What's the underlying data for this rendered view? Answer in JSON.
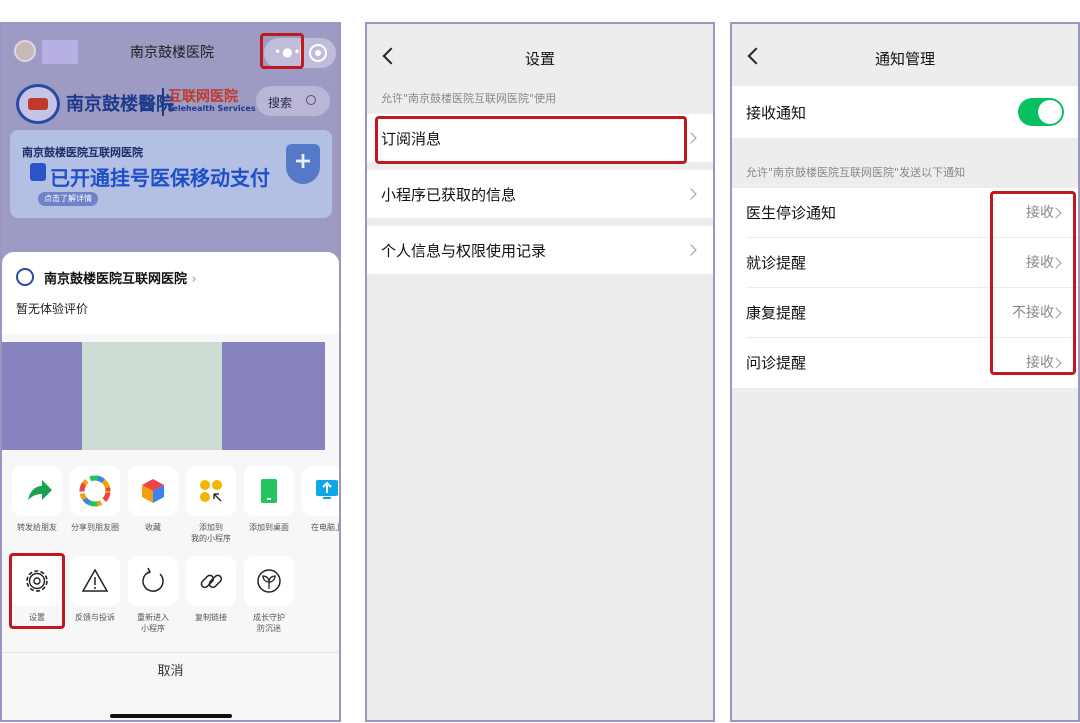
{
  "colors": {
    "accent_green": "#07c160",
    "highlight_red": "#c0191d",
    "panel_border": "#9b97c4"
  },
  "panel1": {
    "title": "南京鼓楼医院",
    "logo_text": "南京鼓楼醫院",
    "logo_net": "互联网医院",
    "logo_en": "Telehealth Services",
    "search_label": "搜索",
    "banner_heading": "南京鼓楼医院互联网医院",
    "banner_main": "已开通挂号医保移动支付",
    "banner_link": "点击了解详情",
    "sheet": {
      "app_name": "南京鼓楼医院互联网医院",
      "rating_text": "暂无体验评价",
      "actions_row1": [
        {
          "label": "转发给朋友",
          "icon": "share-arrow-icon"
        },
        {
          "label": "分享到朋友圈",
          "icon": "moments-icon"
        },
        {
          "label": "收藏",
          "icon": "favorite-cube-icon"
        },
        {
          "label": "添加到\n我的小程序",
          "icon": "my-miniprogram-icon"
        },
        {
          "label": "添加到桌面",
          "icon": "desktop-icon"
        },
        {
          "label": "在电脑上",
          "icon": "computer-icon"
        }
      ],
      "actions_row2": [
        {
          "label": "设置",
          "icon": "gear-icon"
        },
        {
          "label": "反馈与投诉",
          "icon": "warning-icon"
        },
        {
          "label": "重新进入\n小程序",
          "icon": "reload-icon"
        },
        {
          "label": "复制链接",
          "icon": "link-icon"
        },
        {
          "label": "成长守护\n防沉迷",
          "icon": "sprout-icon"
        }
      ],
      "cancel_label": "取消"
    }
  },
  "panel2": {
    "title": "设置",
    "caption": "允许\"南京鼓楼医院互联网医院\"使用",
    "items": [
      {
        "label": "订阅消息"
      },
      {
        "label": "小程序已获取的信息"
      },
      {
        "label": "个人信息与权限使用记录"
      }
    ]
  },
  "panel3": {
    "title": "通知管理",
    "receive_label": "接收通知",
    "receive_on": true,
    "caption": "允许\"南京鼓楼医院互联网医院\"发送以下通知",
    "items": [
      {
        "label": "医生停诊通知",
        "value": "接收"
      },
      {
        "label": "就诊提醒",
        "value": "接收"
      },
      {
        "label": "康复提醒",
        "value": "不接收"
      },
      {
        "label": "问诊提醒",
        "value": "接收"
      }
    ]
  }
}
